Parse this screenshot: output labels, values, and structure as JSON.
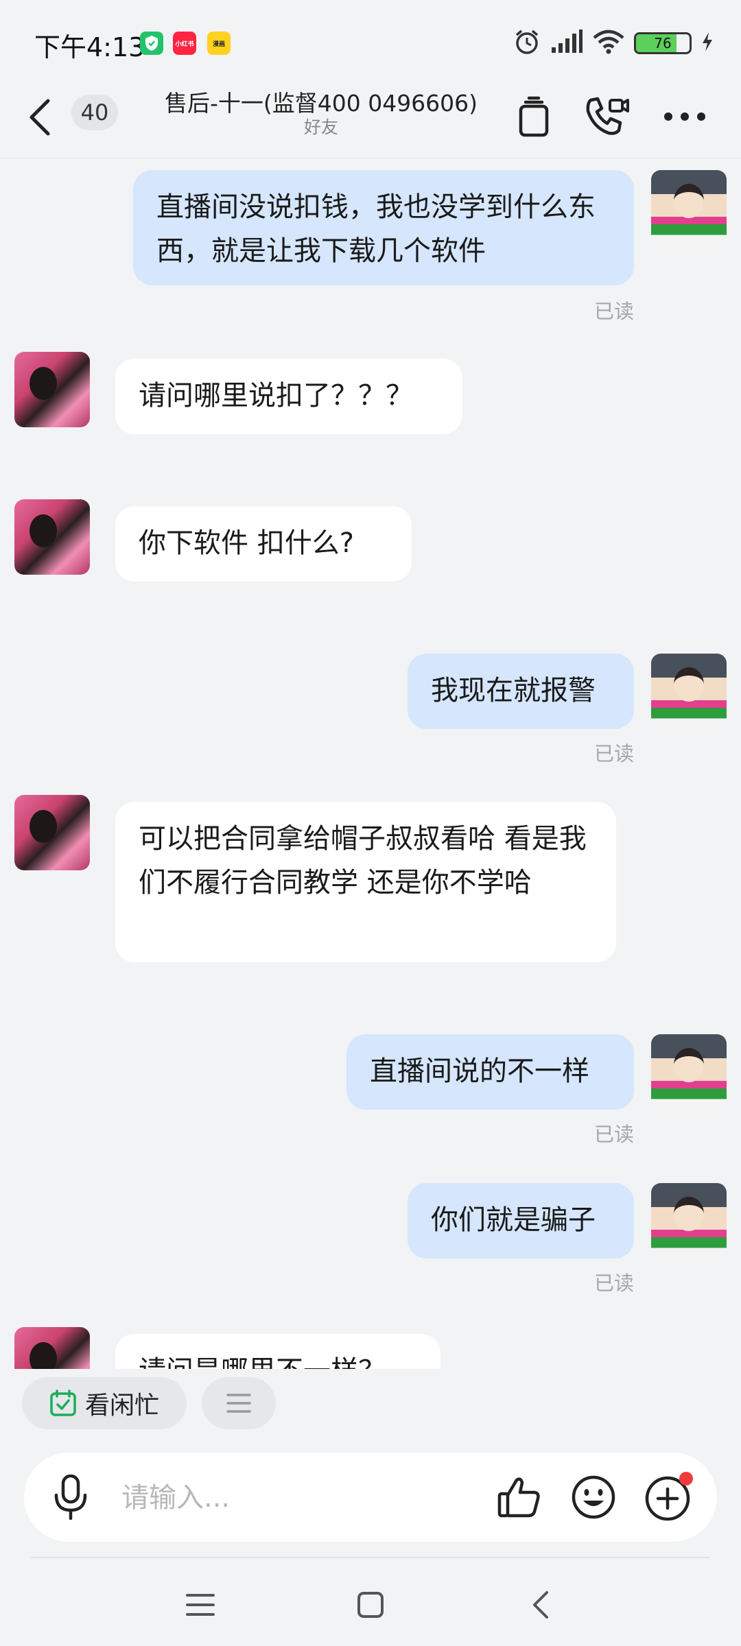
{
  "status_bar": {
    "time": "下午4:13",
    "apps": [
      "小红书",
      "漫画"
    ],
    "battery": 76,
    "icons": [
      "alarm-icon",
      "signal-icon",
      "wifi-icon",
      "battery-icon",
      "charging-icon"
    ]
  },
  "header": {
    "unread_count": "40",
    "title": "售后-十一(监督400 0496606)",
    "subtitle": "好友",
    "icons": [
      "back-icon",
      "clipboard-icon",
      "call-video-icon",
      "more-icon"
    ]
  },
  "messages": [
    {
      "sender": "me",
      "text": "直播间没说扣钱，我也没学到什么东西，就是让我下载几个软件",
      "status": "已读"
    },
    {
      "sender": "other",
      "text": "请问哪里说扣了？？？"
    },
    {
      "sender": "other",
      "text": "你下软件 扣什么?"
    },
    {
      "sender": "me",
      "text": "我现在就报警",
      "status": "已读"
    },
    {
      "sender": "other",
      "text": "可以把合同拿给帽子叔叔看哈  看是我们不履行合同教学 还是你不学哈"
    },
    {
      "sender": "me",
      "text": "直播间说的不一样",
      "status": "已读"
    },
    {
      "sender": "me",
      "text": "你们就是骗子",
      "status": "已读"
    },
    {
      "sender": "other",
      "text": "请问是哪里不一样？"
    }
  ],
  "quick_actions": {
    "availability_label": "看闲忙",
    "icons": [
      "calendar-check-icon",
      "menu-icon"
    ]
  },
  "input": {
    "placeholder": "请输入...",
    "icons": [
      "microphone-icon",
      "thumbs-up-icon",
      "emoji-icon",
      "plus-icon"
    ]
  },
  "colors": {
    "my_bubble": "#d5e6fd",
    "other_bubble": "#ffffff",
    "background": "#f2f3f5",
    "read_label": "#a6a6a6",
    "notification_dot": "#f23b3b"
  }
}
